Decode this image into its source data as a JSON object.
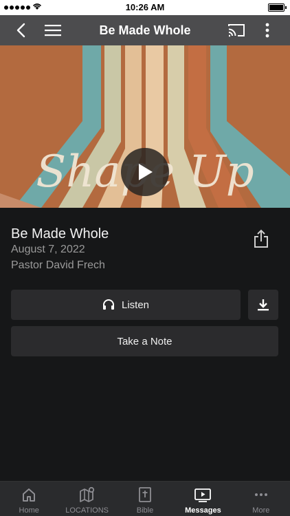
{
  "status_bar": {
    "time": "10:26 AM"
  },
  "app_bar": {
    "title": "Be Made Whole"
  },
  "hero": {
    "artwork_text": "Shape Up"
  },
  "message": {
    "title": "Be Made Whole",
    "date": "August 7, 2022",
    "speaker": "Pastor David Frech"
  },
  "actions": {
    "listen_label": "Listen",
    "note_label": "Take a Note"
  },
  "tabs": [
    {
      "label": "Home",
      "icon": "home-icon"
    },
    {
      "label": "LOCATIONS",
      "icon": "map-pin-icon"
    },
    {
      "label": "Bible",
      "icon": "bible-icon"
    },
    {
      "label": "Messages",
      "icon": "play-screen-icon",
      "active": true
    },
    {
      "label": "More",
      "icon": "more-dots-icon"
    }
  ],
  "colors": {
    "app_bar": "#4c4c4e",
    "background": "#161718",
    "button": "#2b2b2d",
    "secondary_text": "#9a9a9a",
    "tab_bar": "#2a2b2d"
  }
}
